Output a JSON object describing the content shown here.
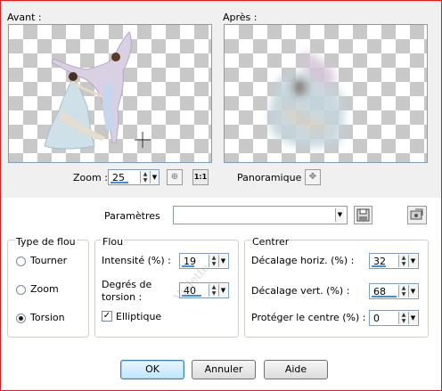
{
  "preview": {
    "before_label": "Avant :",
    "after_label": "Après :"
  },
  "zoom": {
    "label": "Zoom :",
    "value": "25",
    "fit_label": "1:1"
  },
  "pan": {
    "label": "Panoramique :"
  },
  "params": {
    "label": "Paramètres",
    "value": ""
  },
  "blur_type": {
    "title": "Type de flou",
    "options": [
      {
        "label": "Tourner",
        "selected": false
      },
      {
        "label": "Zoom",
        "selected": false
      },
      {
        "label": "Torsion",
        "selected": true
      }
    ]
  },
  "flou": {
    "title": "Flou",
    "intensity_label": "Intensité (%) :",
    "intensity_value": "19",
    "torsion_label_1": "Degrés de",
    "torsion_label_2": "torsion :",
    "torsion_value": "40",
    "elliptique_label": "Elliptique",
    "elliptique_checked": true
  },
  "centre": {
    "title": "Centrer",
    "h_offset_label": "Décalage horiz. (%) :",
    "h_offset_value": "32",
    "v_offset_label": "Décalage vert. (%) :",
    "v_offset_value": "68",
    "protect_label": "Protéger le centre (%) :",
    "protect_value": "0"
  },
  "buttons": {
    "ok": "OK",
    "cancel": "Annuler",
    "help": "Aide"
  },
  "colors": {
    "frame": "#d52020",
    "accent": "#3d8ee0"
  }
}
